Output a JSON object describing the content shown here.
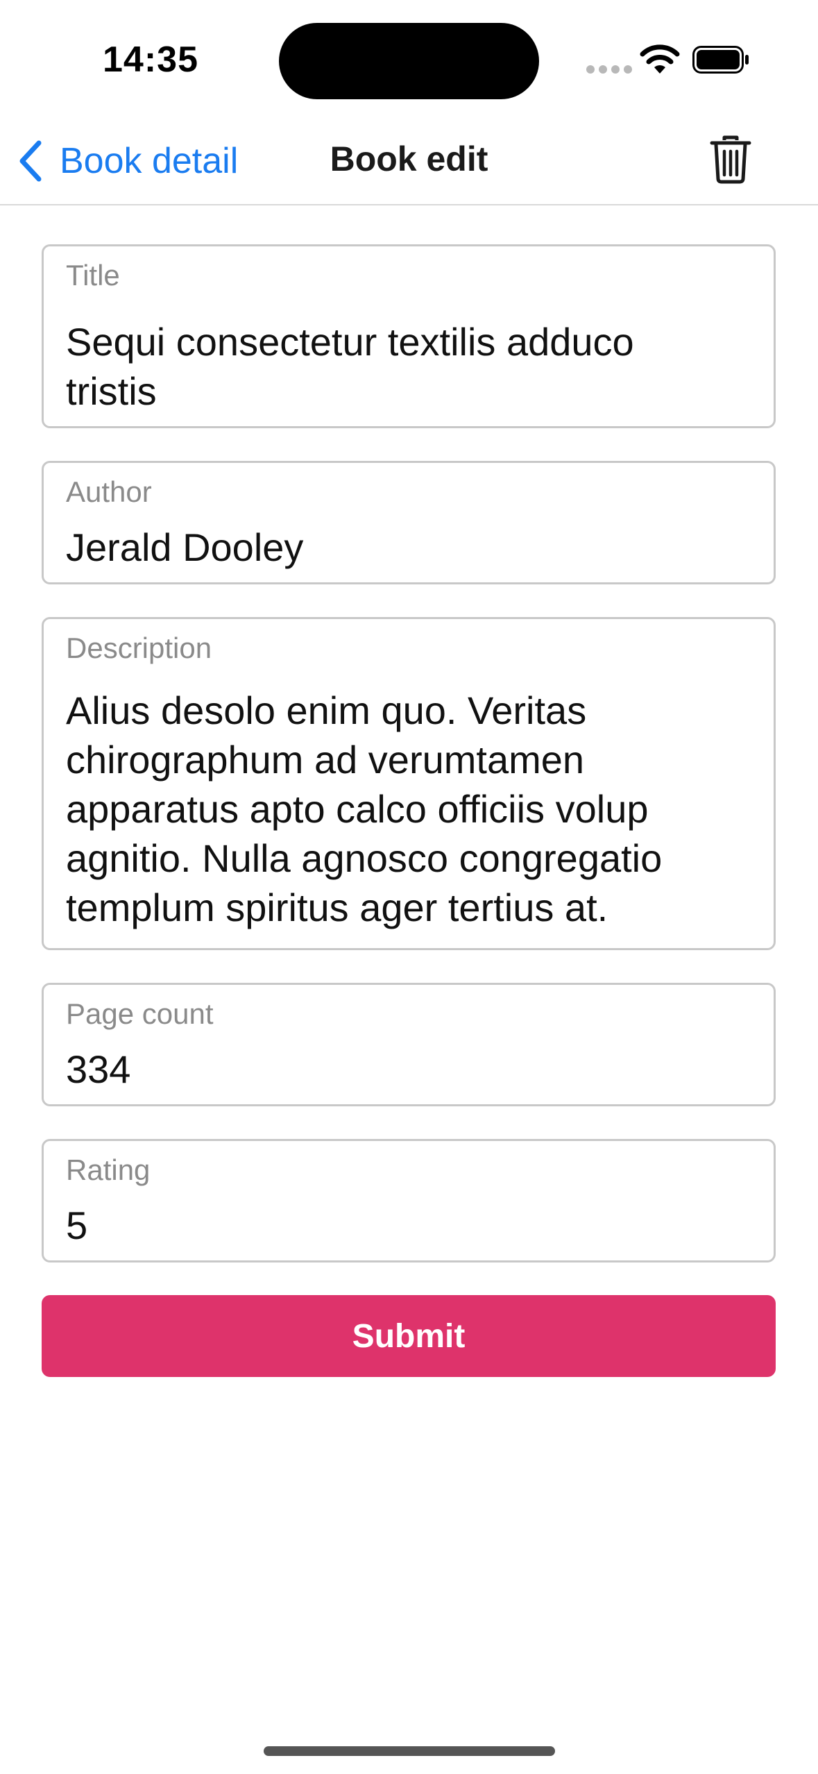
{
  "status_bar": {
    "time": "14:35",
    "icons": [
      "signal-dots-icon",
      "wifi-icon",
      "battery-icon"
    ]
  },
  "nav": {
    "back_label": "Book detail",
    "title": "Book edit",
    "back_icon": "chevron-left-icon",
    "action_icon": "trash-icon"
  },
  "form": {
    "title": {
      "label": "Title",
      "value": "Sequi consectetur textilis adduco\ntristis"
    },
    "author": {
      "label": "Author",
      "value": "Jerald Dooley"
    },
    "description": {
      "label": "Description",
      "value": "Alius desolo enim quo. Veritas\nchirographum ad verumtamen\napparatus apto calco officiis volup\nagnitio. Nulla agnosco congregatio\ntemplum spiritus ager tertius at."
    },
    "page_count": {
      "label": "Page count",
      "value": "334"
    },
    "rating": {
      "label": "Rating",
      "value": "5"
    },
    "submit_label": "Submit"
  },
  "colors": {
    "accent": "#1a7cf0",
    "submit": "#de336b",
    "border": "#c8c8c8",
    "label": "#8a8a8a"
  }
}
